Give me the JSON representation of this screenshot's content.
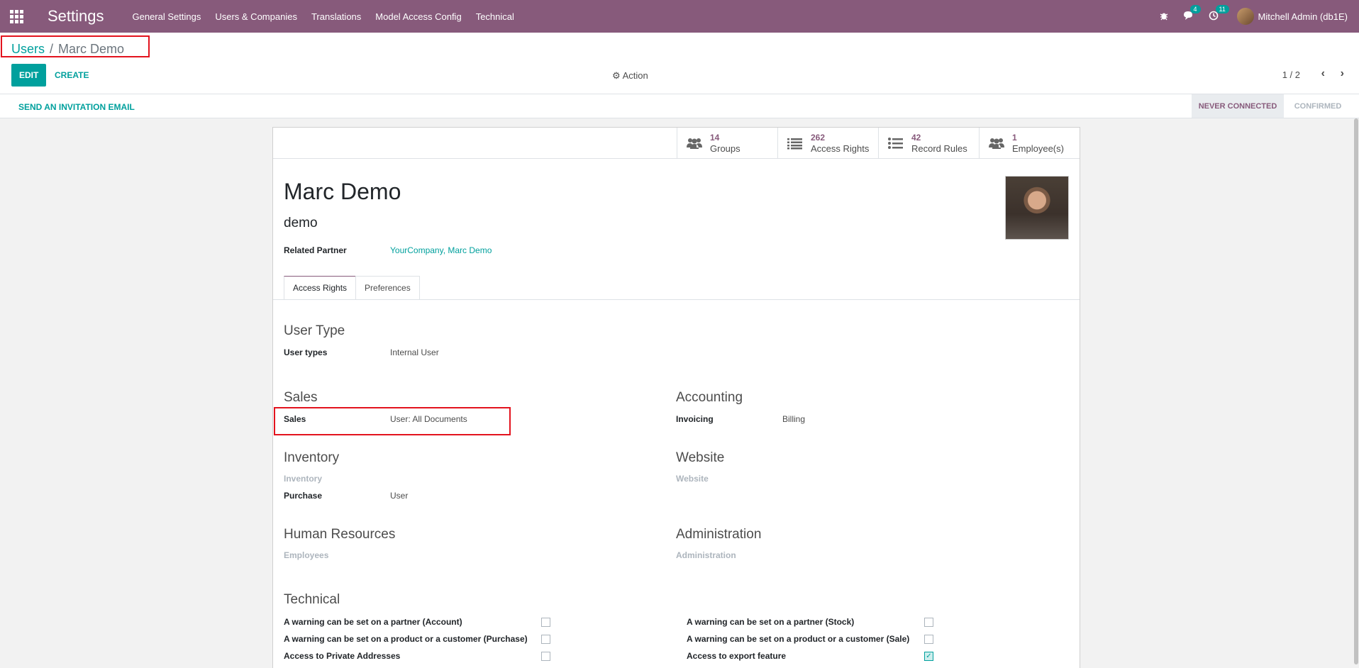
{
  "navbar": {
    "app_title": "Settings",
    "menu": [
      "General Settings",
      "Users & Companies",
      "Translations",
      "Model Access Config",
      "Technical"
    ],
    "messages_count": "4",
    "activities_count": "11",
    "user": "Mitchell Admin (db1E)"
  },
  "breadcrumb": {
    "parent": "Users",
    "current": "Marc Demo"
  },
  "toolbar": {
    "edit": "EDIT",
    "create": "CREATE",
    "action": "Action",
    "pager": "1 / 2"
  },
  "statusbar": {
    "invite": "SEND AN INVITATION EMAIL",
    "stages": [
      "NEVER CONNECTED",
      "CONFIRMED"
    ],
    "active_stage": "NEVER CONNECTED"
  },
  "stat_buttons": [
    {
      "value": "14",
      "label": "Groups",
      "icon": "users-icon"
    },
    {
      "value": "262",
      "label": "Access Rights",
      "icon": "list-icon"
    },
    {
      "value": "42",
      "label": "Record Rules",
      "icon": "list-bullets-icon"
    },
    {
      "value": "1",
      "label": "Employee(s)",
      "icon": "users-icon"
    }
  ],
  "user": {
    "name": "Marc Demo",
    "login": "demo",
    "related_partner_label": "Related Partner",
    "related_partner": "YourCompany, Marc Demo"
  },
  "tabs": [
    "Access Rights",
    "Preferences"
  ],
  "access": {
    "user_type": {
      "title": "User Type",
      "label": "User types",
      "value": "Internal User"
    },
    "sales": {
      "title": "Sales",
      "label": "Sales",
      "value": "User: All Documents"
    },
    "accounting": {
      "title": "Accounting",
      "label": "Invoicing",
      "value": "Billing"
    },
    "inventory": {
      "title": "Inventory",
      "label1": "Inventory",
      "label2": "Purchase",
      "value2": "User"
    },
    "website": {
      "title": "Website",
      "label": "Website"
    },
    "hr": {
      "title": "Human Resources",
      "label": "Employees"
    },
    "administration": {
      "title": "Administration",
      "label": "Administration"
    },
    "technical": {
      "title": "Technical",
      "left": [
        {
          "label": "A warning can be set on a partner (Account)",
          "checked": false
        },
        {
          "label": "A warning can be set on a product or a customer (Purchase)",
          "checked": false
        },
        {
          "label": "Access to Private Addresses",
          "checked": false
        }
      ],
      "right": [
        {
          "label": "A warning can be set on a partner (Stock)",
          "checked": false
        },
        {
          "label": "A warning can be set on a product or a customer (Sale)",
          "checked": false
        },
        {
          "label": "Access to export feature",
          "checked": true
        }
      ]
    }
  },
  "colors": {
    "brand": "#875a7b",
    "accent": "#00a09d",
    "highlight": "#e3131e"
  }
}
